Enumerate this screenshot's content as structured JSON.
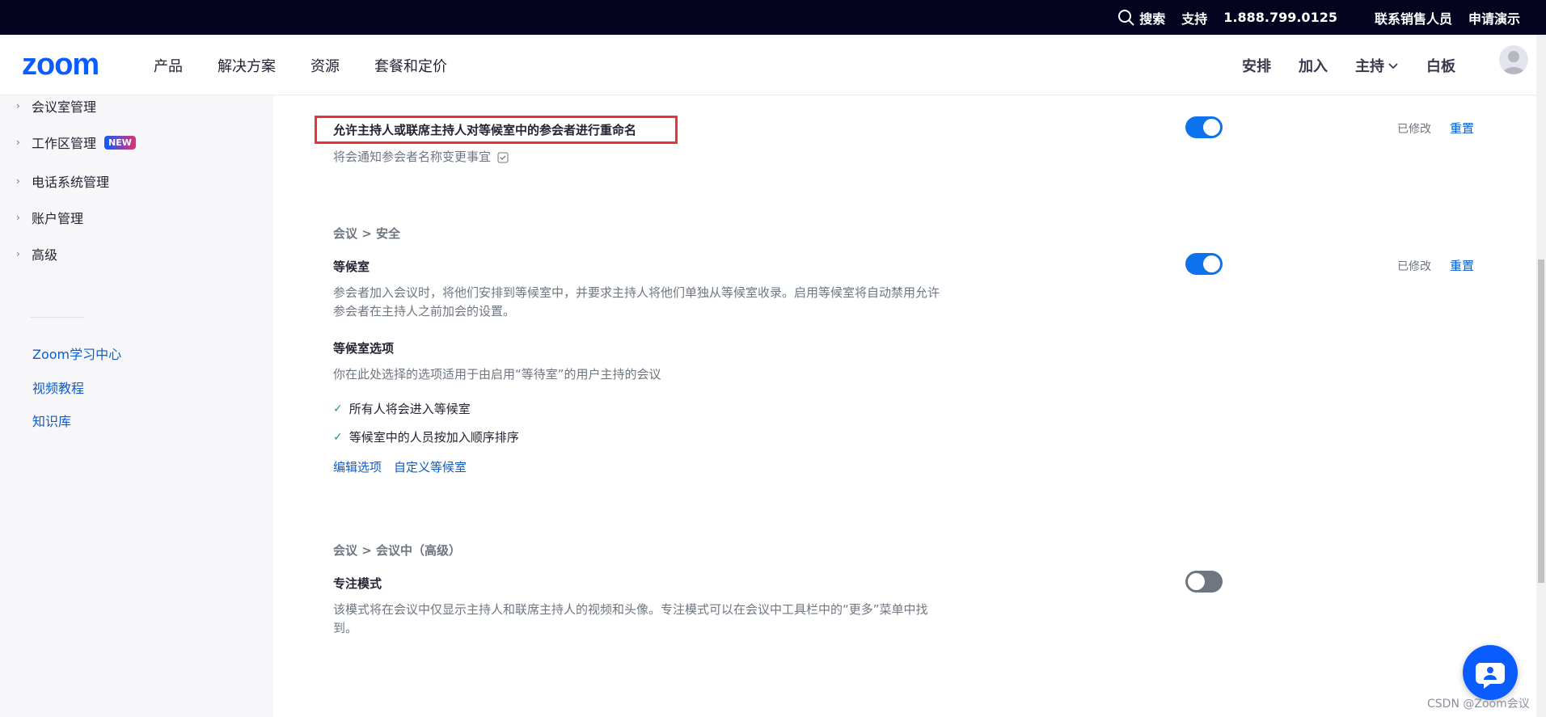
{
  "topbar": {
    "search_label": "搜索",
    "support_label": "支持",
    "phone": "1.888.799.0125",
    "contact_sales": "联系销售人员",
    "request_demo": "申请演示"
  },
  "header": {
    "logo_text": "zoom",
    "nav": [
      "产品",
      "解决方案",
      "资源",
      "套餐和定价"
    ],
    "right_nav": {
      "schedule": "安排",
      "join": "加入",
      "host": "主持",
      "whiteboard": "白板"
    }
  },
  "sidebar": {
    "items": [
      {
        "label": "会议室管理"
      },
      {
        "label": "工作区管理",
        "badge": "NEW"
      },
      {
        "label": "电话系统管理"
      },
      {
        "label": "账户管理"
      },
      {
        "label": "高级"
      }
    ],
    "links": [
      "Zoom学习中心",
      "视频教程",
      "知识库"
    ]
  },
  "settings": {
    "rename": {
      "title": "允许主持人或联席主持人对等候室中的参会者进行重命名",
      "description": "将会通知参会者名称变更事宜",
      "enabled": true,
      "modified_label": "已修改",
      "reset_label": "重置"
    },
    "security_section": "会议 > 安全",
    "waiting_room": {
      "title": "等候室",
      "description_line1": "参会者加入会议时，将他们安排到等候室中，并要求主持人将他们单独从等候室收录。启用等候室将自动禁用允许",
      "description_line2": "参会者在主持人之前加会的设置。",
      "enabled": true,
      "modified_label": "已修改",
      "reset_label": "重置",
      "options_title": "等候室选项",
      "options_description": "你在此处选择的选项适用于由启用“等待室”的用户主持的会议",
      "checks": [
        "所有人将会进入等候室",
        "等候室中的人员按加入顺序排序"
      ],
      "edit_options": "编辑选项",
      "customize": "自定义等候室"
    },
    "advanced_section": "会议 > 会议中（高级）",
    "focus_mode": {
      "title": "专注模式",
      "description_line1": "该模式将在会议中仅显示主持人和联席主持人的视频和头像。专注模式可以在会议中工具栏中的“更多”菜单中找",
      "description_line2": "到。",
      "enabled": false
    }
  },
  "watermark": "CSDN @Zoom会议",
  "colors": {
    "topbar_bg": "#040421",
    "brand_blue": "#0b5cff",
    "toggle_on": "#0e72ed",
    "link": "#0e5cc9",
    "highlight_red": "#e8323c"
  }
}
